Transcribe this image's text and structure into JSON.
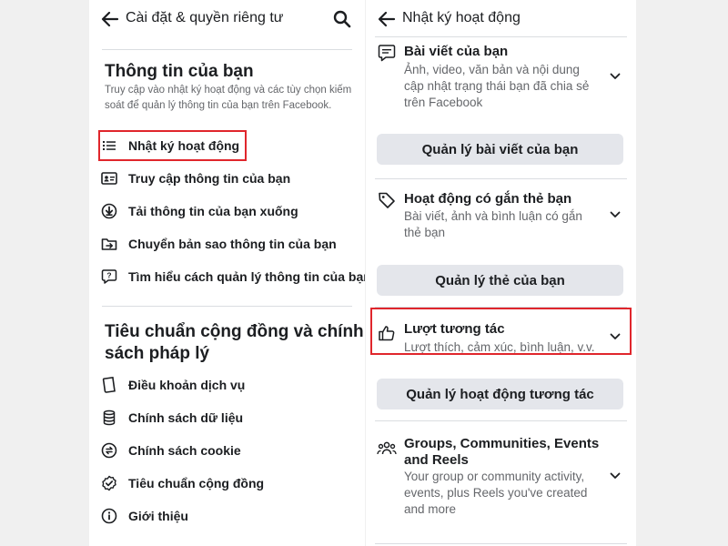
{
  "left": {
    "header": {
      "title": "Cài đặt & quyền riêng tư"
    },
    "section1": {
      "title": "Thông tin của bạn",
      "description": "Truy cập vào nhật ký hoạt động và các tùy chọn kiếm soát để quản lý thông tin của bạn trên Facebook.",
      "items": [
        {
          "label": "Nhật ký hoạt động",
          "icon": "list-icon"
        },
        {
          "label": "Truy cập thông tin của bạn",
          "icon": "id-card-icon"
        },
        {
          "label": "Tải thông tin của bạn xuống",
          "icon": "download-icon"
        },
        {
          "label": "Chuyển bản sao thông tin của bạn",
          "icon": "transfer-folder-icon"
        },
        {
          "label": "Tìm hiểu cách quản lý thông tin của bạn",
          "icon": "help-icon"
        }
      ]
    },
    "section2": {
      "title_line1": "Tiêu chuẩn cộng đồng và chính",
      "title_line2": "sách pháp lý",
      "items": [
        {
          "label": "Điều khoản dịch vụ",
          "icon": "book-icon"
        },
        {
          "label": "Chính sách dữ liệu",
          "icon": "database-icon"
        },
        {
          "label": "Chính sách cookie",
          "icon": "sync-icon"
        },
        {
          "label": "Tiêu chuẩn cộng đồng",
          "icon": "badge-check-icon"
        },
        {
          "label": "Giới thiệu",
          "icon": "info-icon"
        }
      ]
    }
  },
  "right": {
    "header": {
      "title": "Nhật ký hoạt động"
    },
    "items": [
      {
        "title": "Bài viết của bạn",
        "subtitle_lines": [
          "Ảnh, video, văn bản và nội dung",
          "cập nhật trạng thái bạn đã chia sẻ",
          "trên Facebook"
        ],
        "button": "Quản lý bài viết của bạn",
        "icon": "post-icon"
      },
      {
        "title": "Hoạt động có gắn thẻ bạn",
        "subtitle_lines": [
          "Bài viết, ảnh và bình luận có gắn",
          "thẻ bạn"
        ],
        "button": "Quản lý thẻ của bạn",
        "icon": "tag-icon"
      },
      {
        "title": "Lượt tương tác",
        "subtitle_lines": [
          "Lượt thích, cảm xúc, bình luận, v.v."
        ],
        "button": "Quản lý hoạt động tương tác",
        "icon": "thumbs-up-icon"
      },
      {
        "title_lines": [
          "Groups, Communities, Events",
          "and Reels"
        ],
        "subtitle_lines": [
          "Your group or community activity,",
          "events, plus Reels you've created",
          "and more"
        ],
        "icon": "groups-icon"
      }
    ]
  },
  "colors": {
    "highlight": "#e0262c",
    "button_bg": "#e4e6eb",
    "text": "#1c1e21",
    "secondary_text": "#65676b"
  }
}
